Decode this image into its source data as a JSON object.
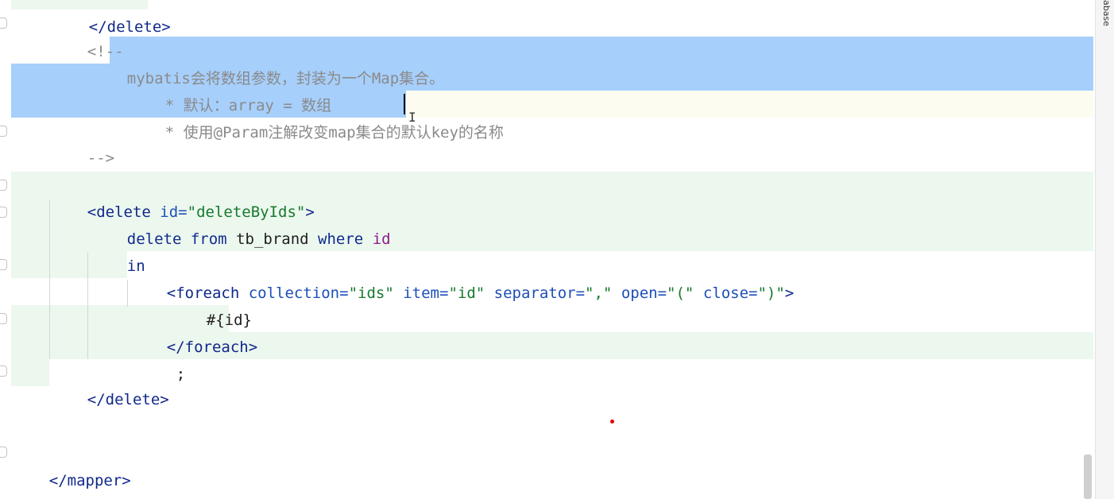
{
  "side_panel": {
    "label": "abase"
  },
  "code_lines": [
    {
      "id": "close-delete-top",
      "text": "</delete>"
    },
    {
      "id": "comment-open",
      "text": "<!--"
    },
    {
      "id": "comment-1-a",
      "text": "my"
    },
    {
      "id": "comment-1-b",
      "text": "batis会将数组参数，封装为一个Map集合。"
    },
    {
      "id": "comment-2",
      "text": "* 默认：array = 数组"
    },
    {
      "id": "comment-3-a",
      "text": "* 使用@Param注解改变map集合的默"
    },
    {
      "id": "comment-3-b",
      "text": "认key的名称"
    },
    {
      "id": "comment-close",
      "text": "-->"
    }
  ],
  "delete_block": {
    "open_tag": "<delete",
    "id_attr": "id=",
    "id_value": "\"deleteByIds\"",
    "open_end": ">",
    "sql_kw_delete": "delete",
    "sql_kw_from": "from",
    "sql_table": "tb_brand",
    "sql_kw_where": "where",
    "sql_col": "id",
    "sql_kw_in": "in",
    "foreach_open": "<foreach",
    "attr_collection": "collection=",
    "val_collection": "\"ids\"",
    "attr_item": "item=",
    "val_item": "\"id\"",
    "attr_separator": "separator=",
    "val_separator": "\",\"",
    "attr_open": "open=",
    "val_open": "\"(\"",
    "attr_close": "close=",
    "val_close": "\")\"",
    "foreach_open_end": ">",
    "placeholder": "#{id}",
    "foreach_close": "</foreach>",
    "semicolon": ";",
    "close_tag": "</delete>"
  },
  "mapper_close": "</mapper>",
  "colors": {
    "selection": "#a6cffb",
    "changed_line": "#ecf7ee",
    "tag": "#10288a",
    "string": "#167a2e",
    "comment": "#8a8a8a"
  }
}
